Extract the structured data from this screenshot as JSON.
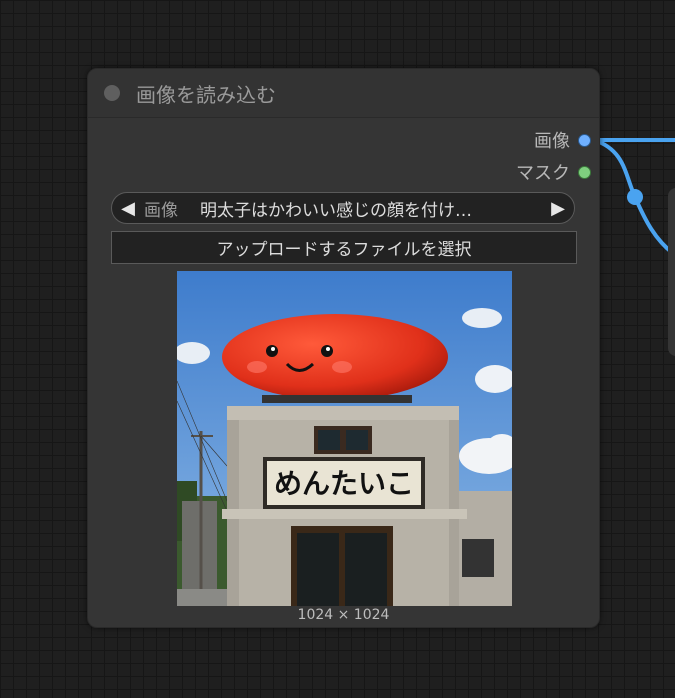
{
  "node": {
    "title": "画像を読み込む",
    "outputs": [
      {
        "label": "画像",
        "color": "#6fb0ff"
      },
      {
        "label": "マスク",
        "color": "#7fcf7f"
      }
    ],
    "combo": {
      "label": "画像",
      "value": "明太子はかわいい感じの顔を付け…",
      "prev_icon": "triangle-left-icon",
      "next_icon": "triangle-right-icon"
    },
    "upload_button": "アップロードするファイルを選択",
    "preview": {
      "sign_text": "めんたいこ",
      "size_text": "1024 × 1024"
    }
  },
  "colors": {
    "link": "#4aa3f0",
    "node_bg": "#353535"
  }
}
